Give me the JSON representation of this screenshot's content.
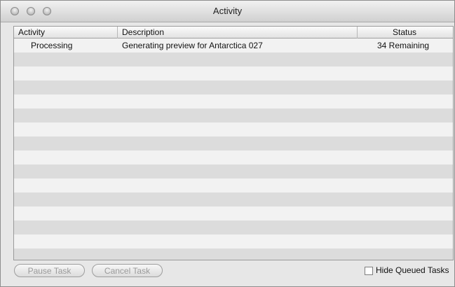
{
  "window": {
    "title": "Activity"
  },
  "table": {
    "columns": [
      "Activity",
      "Description",
      "Status"
    ],
    "rows": [
      {
        "activity": "Processing",
        "description": "Generating preview for Antarctica 027",
        "status": "34 Remaining"
      }
    ]
  },
  "buttons": {
    "pause": "Pause Task",
    "cancel": "Cancel Task"
  },
  "options": {
    "hide_queued_label": "Hide Queued Tasks",
    "hide_queued_checked": false
  }
}
